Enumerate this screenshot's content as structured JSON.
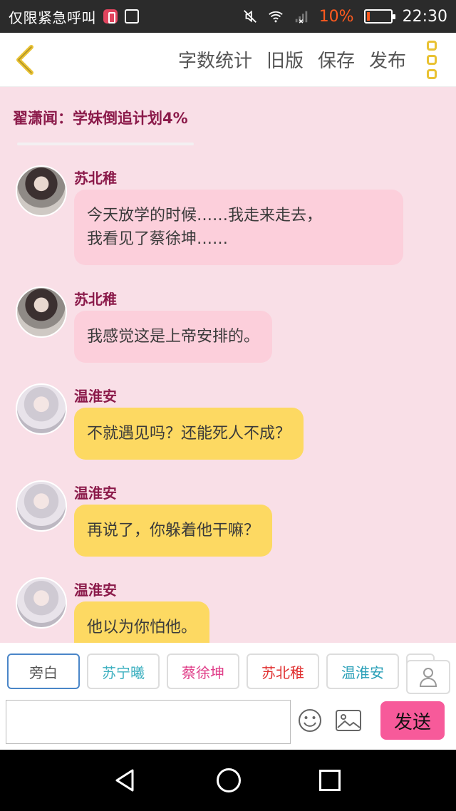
{
  "status_bar": {
    "carrier": "仅限紧急呼叫",
    "battery": "10%",
    "time": "22:30",
    "battery_color": "#ff5a1f"
  },
  "toolbar": {
    "word_count": "字数统计",
    "old_version": "旧版",
    "save": "保存",
    "publish": "发布"
  },
  "title": "翟潇闻：学妹倒追计划4%",
  "messages": [
    {
      "sender": "苏北稚",
      "text": "今天放学的时候……我走来走去，\n我看见了蔡徐坤……",
      "style": "pink",
      "avatar": "dark"
    },
    {
      "sender": "苏北稚",
      "text": "我感觉这是上帝安排的。",
      "style": "pink",
      "avatar": "dark"
    },
    {
      "sender": "温淮安",
      "text": "不就遇见吗？还能死人不成？",
      "style": "yellow",
      "avatar": "light"
    },
    {
      "sender": "温淮安",
      "text": "再说了，你躲着他干嘛？",
      "style": "yellow",
      "avatar": "light"
    },
    {
      "sender": "温淮安",
      "text": "他以为你怕他。",
      "style": "yellow",
      "avatar": "light"
    }
  ],
  "characters": [
    {
      "label": "旁白",
      "color": "#555555"
    },
    {
      "label": "苏宁曦",
      "color": "#3db0c0"
    },
    {
      "label": "蔡徐坤",
      "color": "#e0408a"
    },
    {
      "label": "苏北稚",
      "color": "#e03030"
    },
    {
      "label": "温淮安",
      "color": "#2aa0b8"
    }
  ],
  "input": {
    "value": "",
    "send_label": "发送"
  },
  "colors": {
    "background": "#f9dfe7",
    "title": "#8b1a4a",
    "bubble_pink": "#fccfdb",
    "bubble_yellow": "#fdd962",
    "send_button": "#f75a9a",
    "menu_accent": "#e9c233"
  },
  "icons": {
    "back": "chevron-left-icon",
    "more": "more-vertical-icon",
    "person": "person-icon",
    "emoji": "smiley-icon",
    "image": "image-icon"
  }
}
